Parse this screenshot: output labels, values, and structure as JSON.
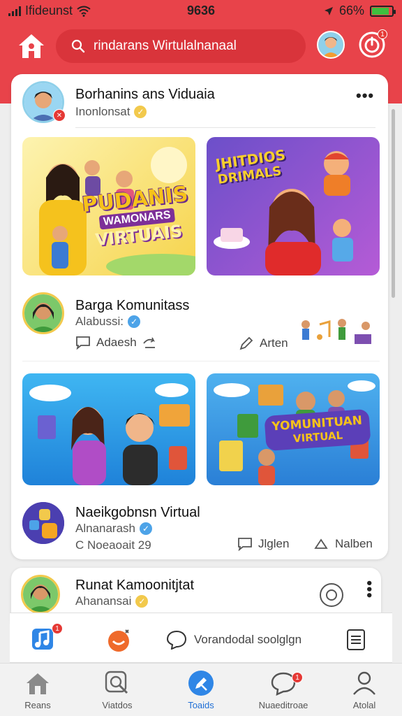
{
  "status_bar": {
    "carrier": "Ifideunst",
    "time": "9636",
    "battery": "66%",
    "battery_fraction": 0.85
  },
  "header": {
    "search_placeholder": "rindarans Wirtulalnanaal",
    "icons": [
      "home-icon",
      "search-icon",
      "avatar",
      "power-icon"
    ],
    "accent": "#e8434a"
  },
  "posts": [
    {
      "title": "Borhanins ans Viduaia",
      "subtitle": "Inonlonsat",
      "tile_left_text_1": "PUDANIS",
      "tile_left_text_2": "WAMONARS",
      "tile_left_text_3": "VIRTUAIS",
      "tile_right_text_1": "JHITDIOS",
      "tile_right_text_2": "DRIMALS"
    },
    {
      "title": "Barga Komunitass",
      "subtitle": "Alabussi:",
      "action_left": "Adaesh",
      "action_right": "Arten",
      "tile_right_text_1": "YOMUNITUAN",
      "tile_right_text_2": "VIRTUAL"
    },
    {
      "title": "Naeikgobnsn Virtual",
      "subtitle": "Alnanarash",
      "meta": "C Noeaoait 29",
      "action_left": "Jlglen",
      "action_right": "Nalben"
    },
    {
      "title": "Runat Kamoonitjtat",
      "subtitle": "Ahanansai"
    }
  ],
  "quickbar": {
    "text": "Vorandodal soolglgn",
    "badge_count": "1"
  },
  "bottom_nav": [
    {
      "label": "Reans",
      "icon": "home-icon",
      "active": false
    },
    {
      "label": "Viatdos",
      "icon": "search-icon",
      "active": false
    },
    {
      "label": "Toaids",
      "icon": "edit-icon",
      "active": true
    },
    {
      "label": "Nuaeditroae",
      "icon": "chat-icon",
      "active": false
    },
    {
      "label": "Atolal",
      "icon": "profile-icon",
      "active": false
    }
  ]
}
